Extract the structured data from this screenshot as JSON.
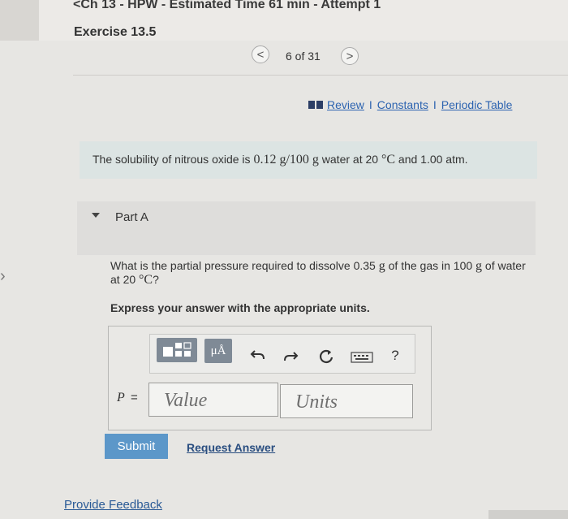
{
  "header": {
    "assignment_title": "<Ch 13 - HPW - Estimated Time 61 min - Attempt 1",
    "exercise_title": "Exercise 13.5"
  },
  "pagination": {
    "prev_glyph": "<",
    "next_glyph": ">",
    "counter": "6 of 31"
  },
  "resources": {
    "review": "Review",
    "separator": "I",
    "constants": "Constants",
    "periodic_table": "Periodic Table"
  },
  "problem": {
    "text_before": "The solubility of nitrous oxide is ",
    "quantity": "0.12 g/100 g",
    "text_middle": " water at 20 ",
    "degree_unit": "°C",
    "text_after": " and 1.00 atm."
  },
  "part": {
    "label": "Part A",
    "question_before": "What is the partial pressure required to dissolve 0.35 ",
    "question_unit1": "g",
    "question_middle": " of the gas in 100 ",
    "question_unit2": "g",
    "question_after": " of water at 20 ",
    "question_degree": "°C",
    "question_end": "?",
    "instruction": "Express your answer with the appropriate units."
  },
  "answer": {
    "variable": "P",
    "equals": " =",
    "value_placeholder": "Value",
    "units_placeholder": "Units",
    "toolbar": {
      "units_button": "μÅ",
      "undo_icon": "undo-icon",
      "redo_icon": "redo-icon",
      "reset_icon": "reset-icon",
      "keyboard_icon": "keyboard-icon",
      "help_label": "?"
    }
  },
  "actions": {
    "submit": "Submit",
    "request_answer": "Request Answer",
    "provide_feedback": "Provide Feedback"
  },
  "colors": {
    "link": "#2c63b0",
    "submit_bg": "#5c97c9",
    "statement_bg": "#dce4e3",
    "toolbar_button": "#7f8a96"
  }
}
